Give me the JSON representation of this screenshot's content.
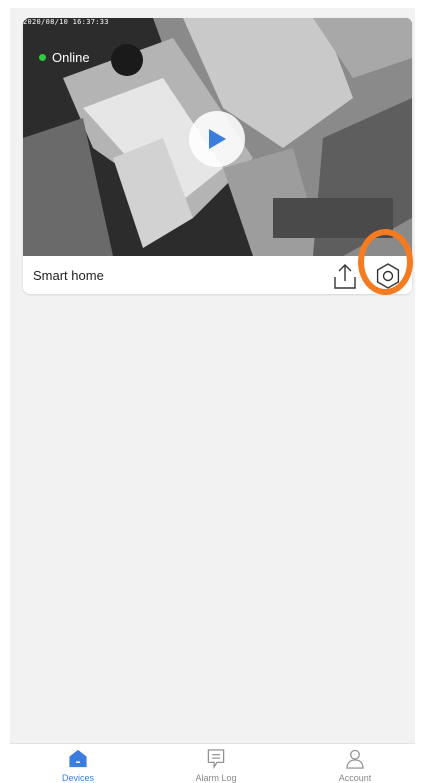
{
  "device": {
    "timestamp": "2020/08/10 16:37:33",
    "status": "Online",
    "status_color": "#2ecc40",
    "name": "Smart home",
    "icons": {
      "play": "play-icon",
      "share": "share-icon",
      "settings": "settings-icon"
    }
  },
  "highlight_color": "#f47b20",
  "accent_color": "#3b7ddd",
  "tabs": [
    {
      "label": "Devices",
      "icon": "home-icon",
      "active": true
    },
    {
      "label": "Alarm Log",
      "icon": "alarm-log-icon",
      "active": false
    },
    {
      "label": "Account",
      "icon": "account-icon",
      "active": false
    }
  ]
}
